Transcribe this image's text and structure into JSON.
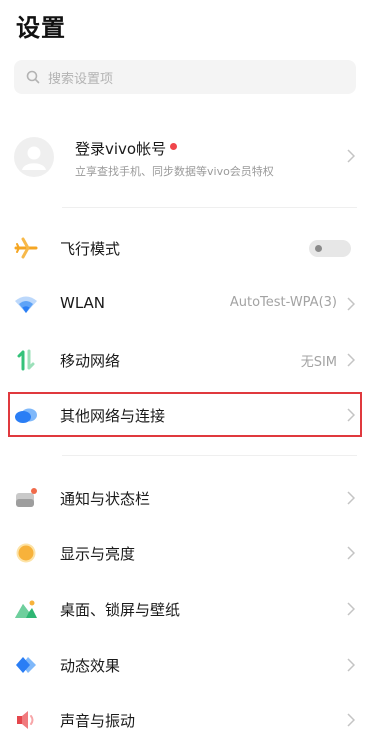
{
  "header": {
    "title": "设置"
  },
  "search": {
    "placeholder": "搜索设置项",
    "icon": "search-icon"
  },
  "account": {
    "title": "登录vivo帐号",
    "subtitle": "立享查找手机、同步数据等vivo会员特权",
    "badge_color": "#f0464b"
  },
  "settings": {
    "airplane": {
      "label": "飞行模式",
      "icon": "airplane-icon",
      "enabled": false
    },
    "wlan": {
      "label": "WLAN",
      "value": "AutoTest-WPA(3)",
      "icon": "wifi-icon"
    },
    "mobile": {
      "label": "移动网络",
      "value": "无SIM",
      "icon": "mobile-network-icon"
    },
    "other_networks": {
      "label": "其他网络与连接",
      "icon": "cloud-icon",
      "highlighted": true
    },
    "notifications": {
      "label": "通知与状态栏",
      "icon": "notification-icon"
    },
    "display": {
      "label": "显示与亮度",
      "icon": "sun-icon"
    },
    "wallpaper": {
      "label": "桌面、锁屏与壁纸",
      "icon": "wallpaper-icon"
    },
    "effects": {
      "label": "动态效果",
      "icon": "diamond-icon"
    },
    "sound": {
      "label": "声音与振动",
      "icon": "speaker-icon"
    }
  },
  "colors": {
    "accent": "#2a7ef5",
    "highlight_border": "#e0393e"
  }
}
